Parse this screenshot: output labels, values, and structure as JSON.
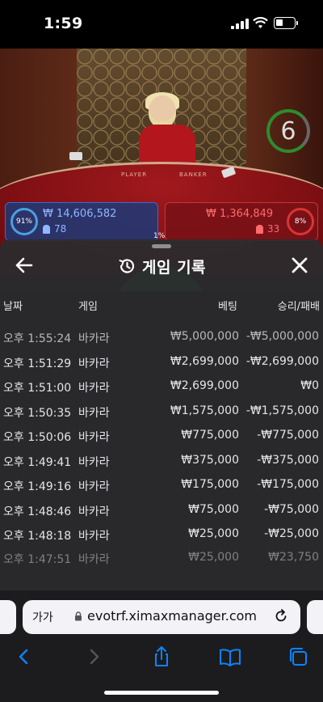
{
  "status_bar": {
    "time": "1:59"
  },
  "game": {
    "countdown": "6",
    "table_player_label": "PLAYER",
    "table_banker_label": "BANKER",
    "player": {
      "percent": "91%",
      "amount": "₩ 14,606,582",
      "count": "78"
    },
    "banker": {
      "percent": "8%",
      "amount": "₩ 1,364,849",
      "count": "33"
    },
    "tie_percent": "1%",
    "colors": {
      "player": "#1c3a78",
      "banker": "#78121a",
      "tie": "#1f7a2b"
    }
  },
  "history": {
    "title": "게임 기록",
    "columns": {
      "date": "날짜",
      "game": "게임",
      "bet": "베팅",
      "result": "승리/패배"
    },
    "rows": [
      {
        "date": "오후 1:55:24",
        "game": "바카라",
        "bet": "₩5,000,000",
        "result": "-₩5,000,000"
      },
      {
        "date": "오후 1:51:29",
        "game": "바카라",
        "bet": "₩2,699,000",
        "result": "-₩2,699,000"
      },
      {
        "date": "오후 1:51:00",
        "game": "바카라",
        "bet": "₩2,699,000",
        "result": "₩0"
      },
      {
        "date": "오후 1:50:35",
        "game": "바카라",
        "bet": "₩1,575,000",
        "result": "-₩1,575,000"
      },
      {
        "date": "오후 1:50:06",
        "game": "바카라",
        "bet": "₩775,000",
        "result": "-₩775,000"
      },
      {
        "date": "오후 1:49:41",
        "game": "바카라",
        "bet": "₩375,000",
        "result": "-₩375,000"
      },
      {
        "date": "오후 1:49:16",
        "game": "바카라",
        "bet": "₩175,000",
        "result": "-₩175,000"
      },
      {
        "date": "오후 1:48:46",
        "game": "바카라",
        "bet": "₩75,000",
        "result": "-₩75,000"
      },
      {
        "date": "오후 1:48:18",
        "game": "바카라",
        "bet": "₩25,000",
        "result": "-₩25,000"
      },
      {
        "date": "오후 1:47:51",
        "game": "바카라",
        "bet": "₩25,000",
        "result": "₩23,750"
      }
    ]
  },
  "browser": {
    "text_size_label": "가가",
    "url": "evotrf.ximaxmanager.com",
    "icons": [
      "back-icon",
      "forward-icon",
      "share-icon",
      "bookmarks-icon",
      "tabs-icon",
      "reload-icon",
      "lock-icon"
    ]
  }
}
